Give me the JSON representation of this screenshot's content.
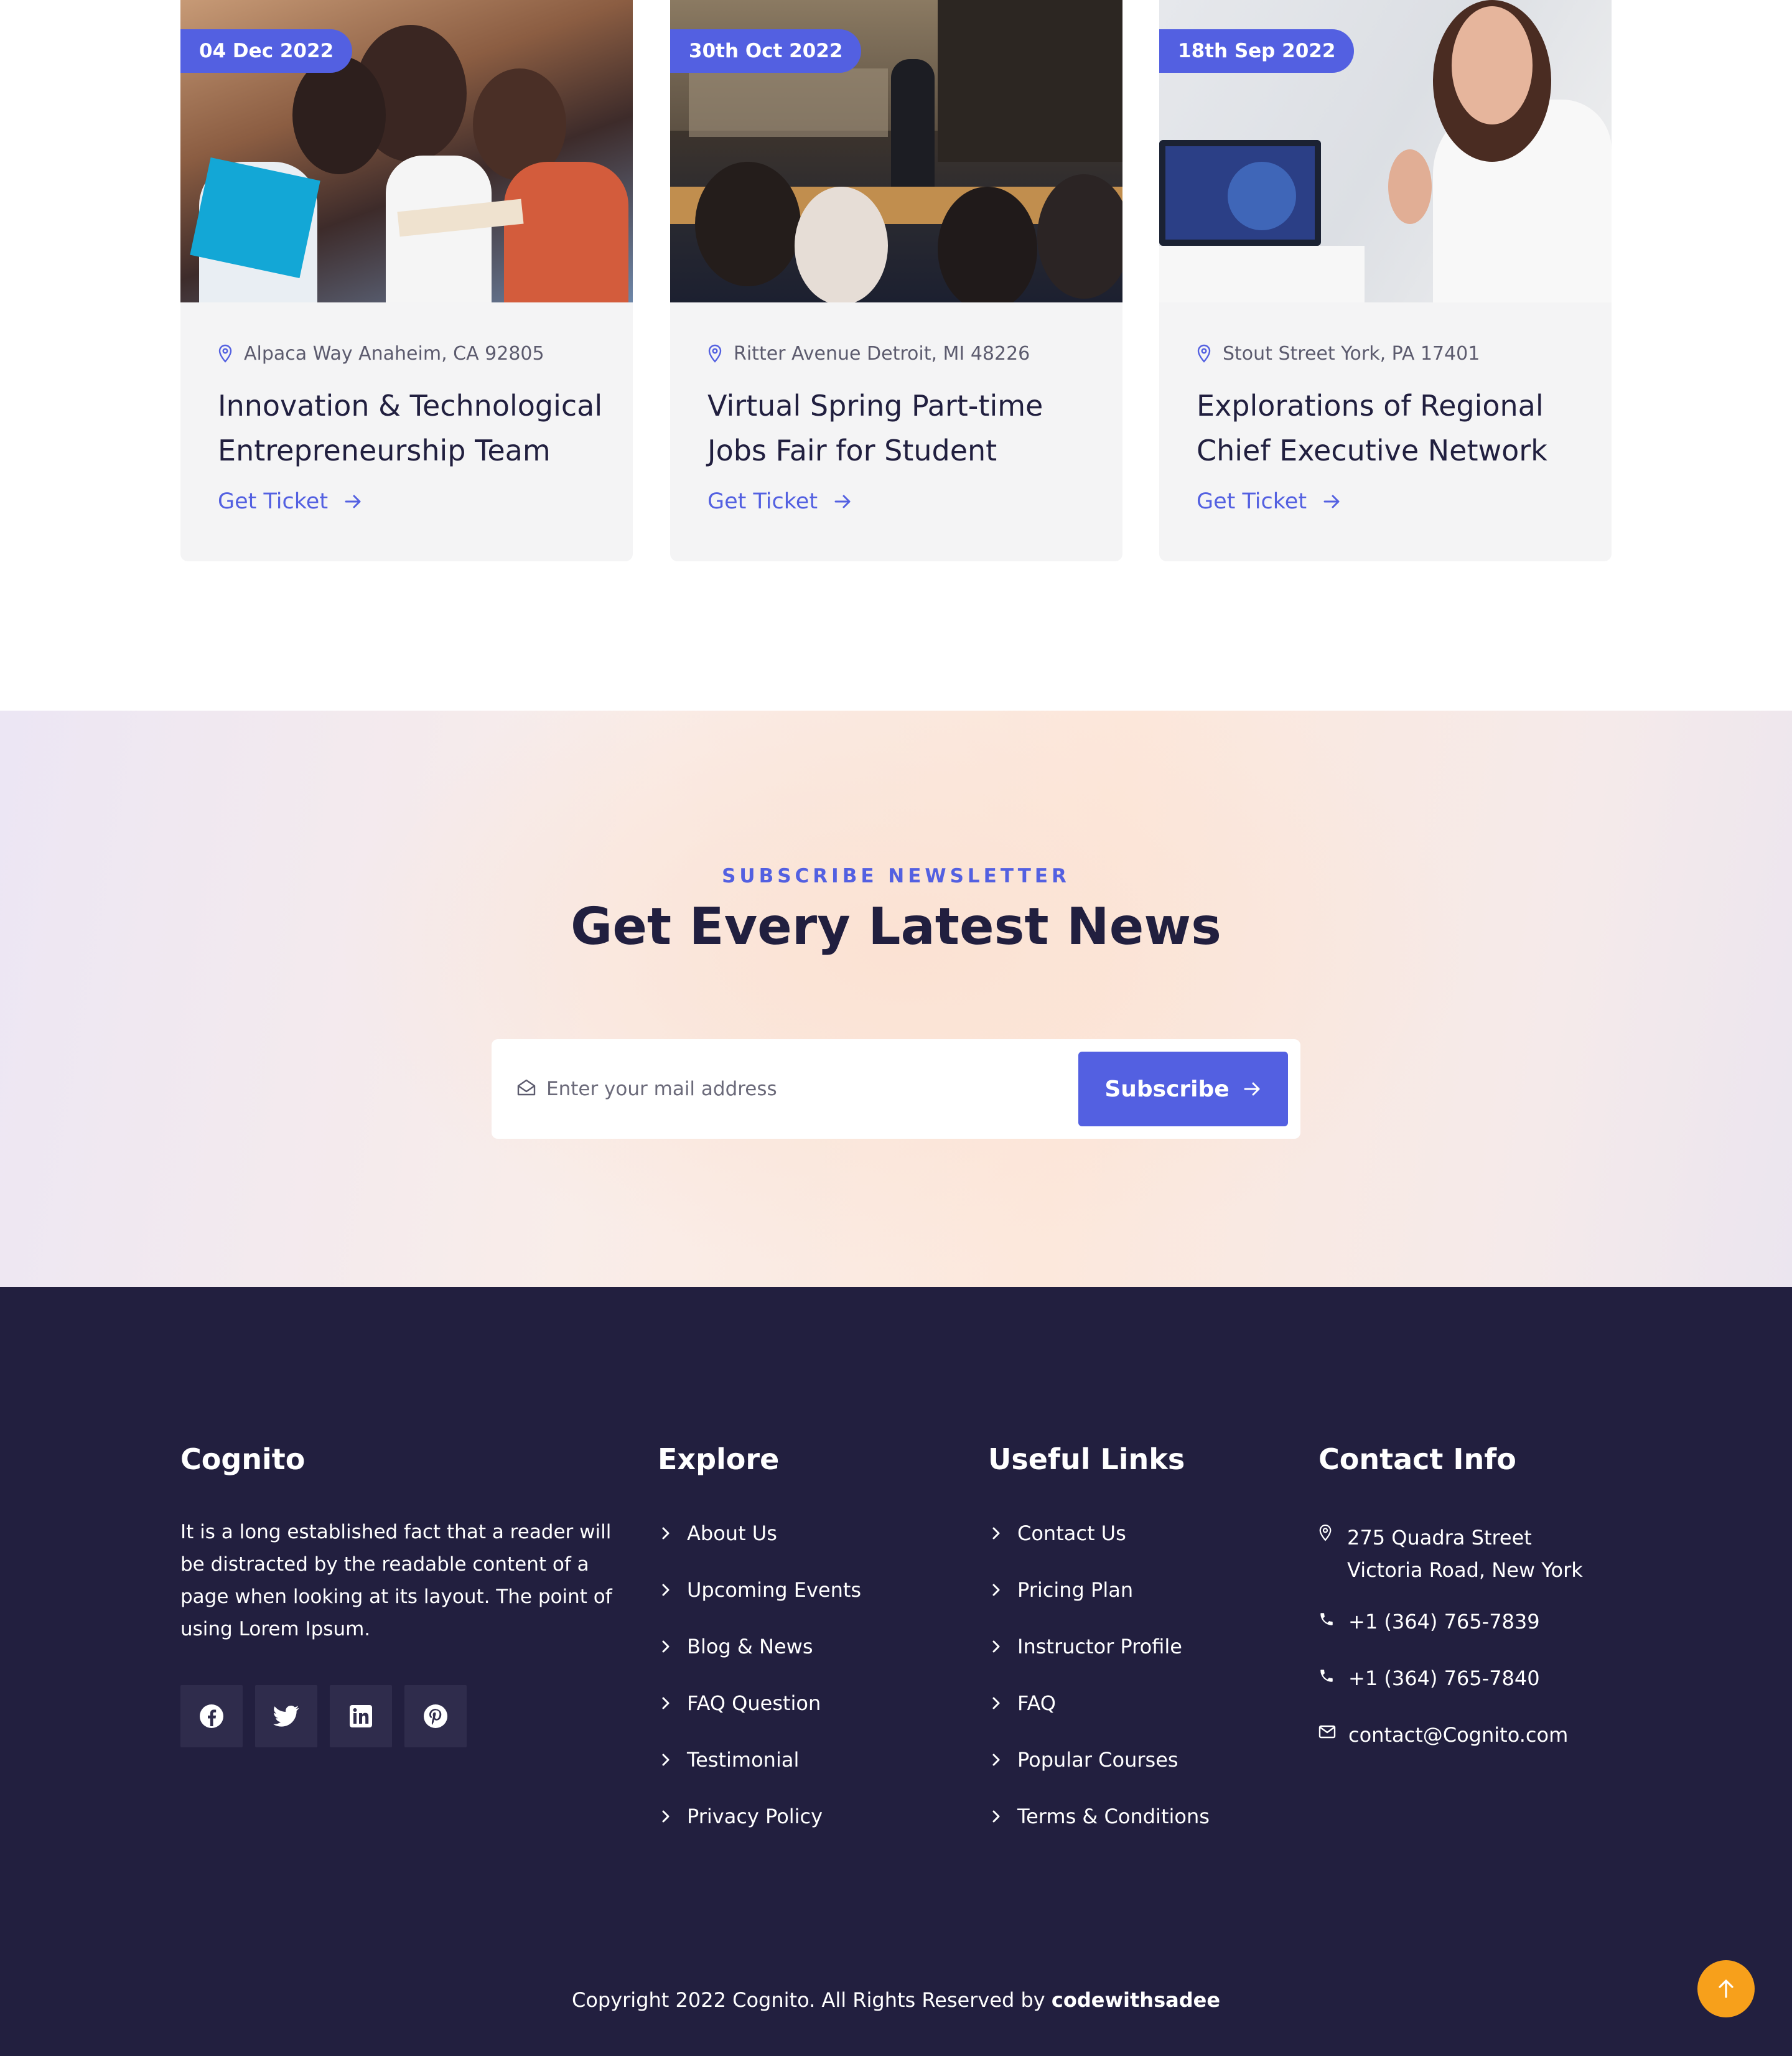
{
  "events": [
    {
      "date": "04 Dec 2022",
      "location": "Alpaca Way Anaheim, CA 92805",
      "title": "Innovation & Technological Entrepreneurship Team",
      "cta": "Get Ticket"
    },
    {
      "date": "30th Oct 2022",
      "location": "Ritter Avenue Detroit, MI 48226",
      "title": "Virtual Spring Part-time Jobs Fair for Student",
      "cta": "Get Ticket"
    },
    {
      "date": "18th Sep 2022",
      "location": "Stout Street York, PA 17401",
      "title": "Explorations of Regional Chief Executive Network",
      "cta": "Get Ticket"
    }
  ],
  "newsletter": {
    "kicker": "SUBSCRIBE NEWSLETTER",
    "title": "Get Every Latest News",
    "input_placeholder": "Enter your mail address",
    "button_label": "Subscribe"
  },
  "footer": {
    "brand": "Cognito",
    "about": "It is a long established fact that a reader will be distracted by the readable content of a page when looking at its layout. The point of using Lorem Ipsum.",
    "socials": [
      "facebook-icon",
      "twitter-icon",
      "linkedin-icon",
      "pinterest-icon"
    ],
    "explore": {
      "heading": "Explore",
      "links": [
        "About Us",
        "Upcoming Events",
        "Blog & News",
        "FAQ Question",
        "Testimonial",
        "Privacy Policy"
      ]
    },
    "useful": {
      "heading": "Useful Links",
      "links": [
        "Contact Us",
        "Pricing Plan",
        "Instructor Profile",
        "FAQ",
        "Popular Courses",
        "Terms & Conditions"
      ]
    },
    "contact": {
      "heading": "Contact Info",
      "address": "275 Quadra Street Victoria Road, New York",
      "phone1": "+1 (364) 765-7839",
      "phone2": "+1 (364) 765-7840",
      "email": "contact@Cognito.com"
    },
    "copyright_prefix": "Copyright 2022 Cognito. All Rights Reserved by ",
    "copyright_author": "codewithsadee"
  },
  "colors": {
    "accent": "#5360e1",
    "footer_bg": "#221f3f",
    "back_to_top": "#f7a01b",
    "heading": "#211f3f"
  }
}
